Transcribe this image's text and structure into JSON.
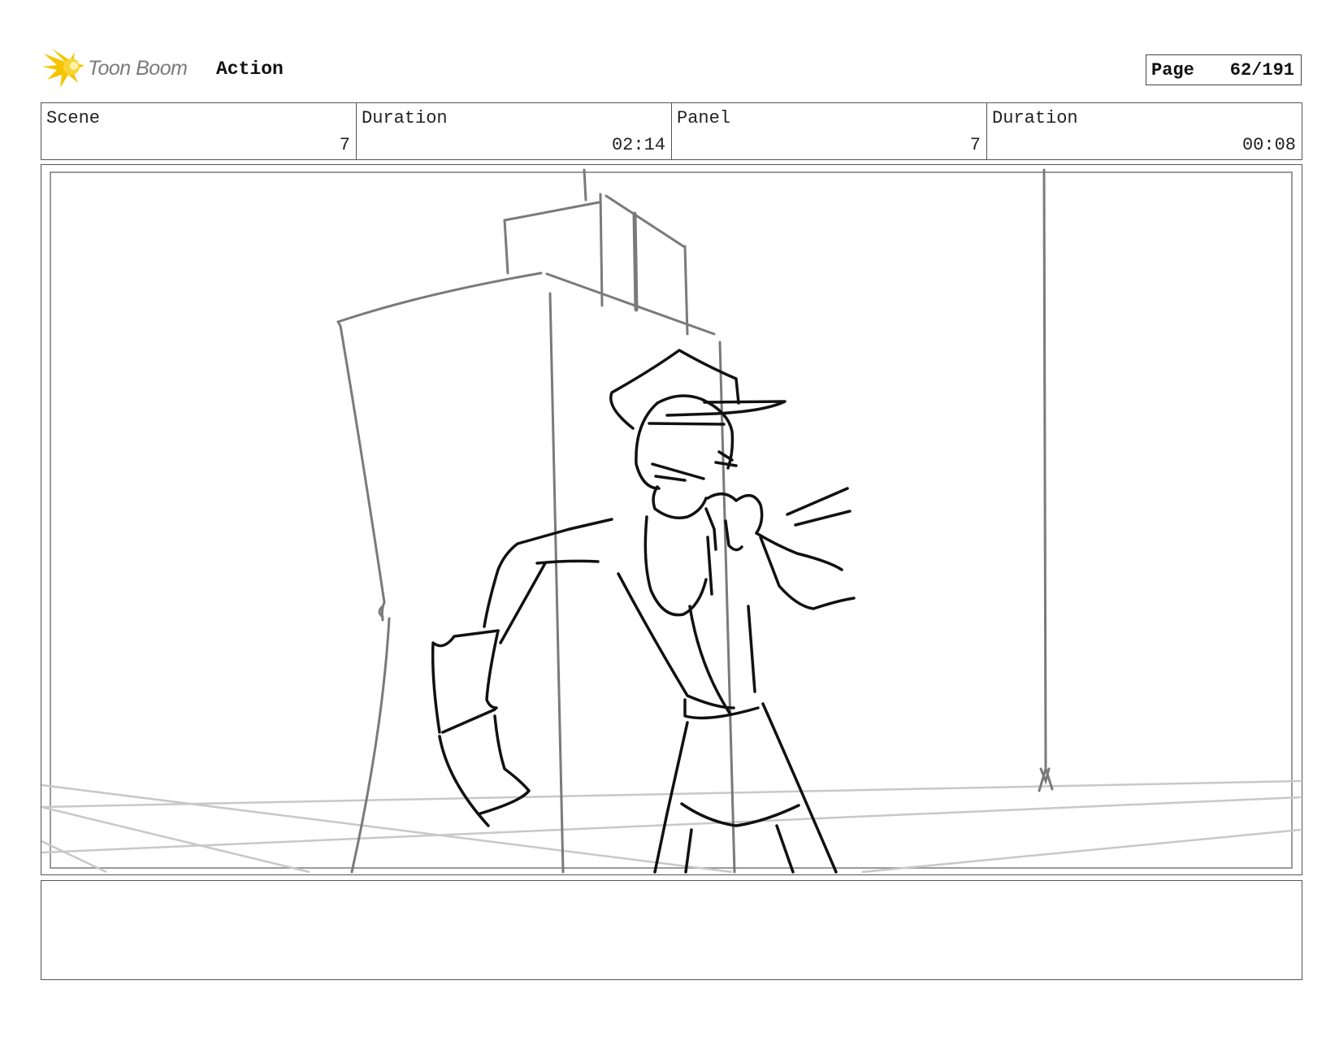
{
  "header": {
    "brand": "Toon Boom",
    "section_title": "Action",
    "page_label": "Page",
    "page_number": "62/191"
  },
  "info": {
    "scene_label": "Scene",
    "scene_value": "7",
    "scene_duration_label": "Duration",
    "scene_duration_value": "02:14",
    "panel_label": "Panel",
    "panel_value": "7",
    "panel_duration_label": "Duration",
    "panel_duration_value": "00:08"
  },
  "colors": {
    "logo_yellow": "#f5c400",
    "sketch_black": "#111111",
    "sketch_gray": "#7a7a7a",
    "guide_lightgray": "#c8c8c8"
  },
  "icons": [
    "toon-boom-logo-icon"
  ],
  "notes": ""
}
